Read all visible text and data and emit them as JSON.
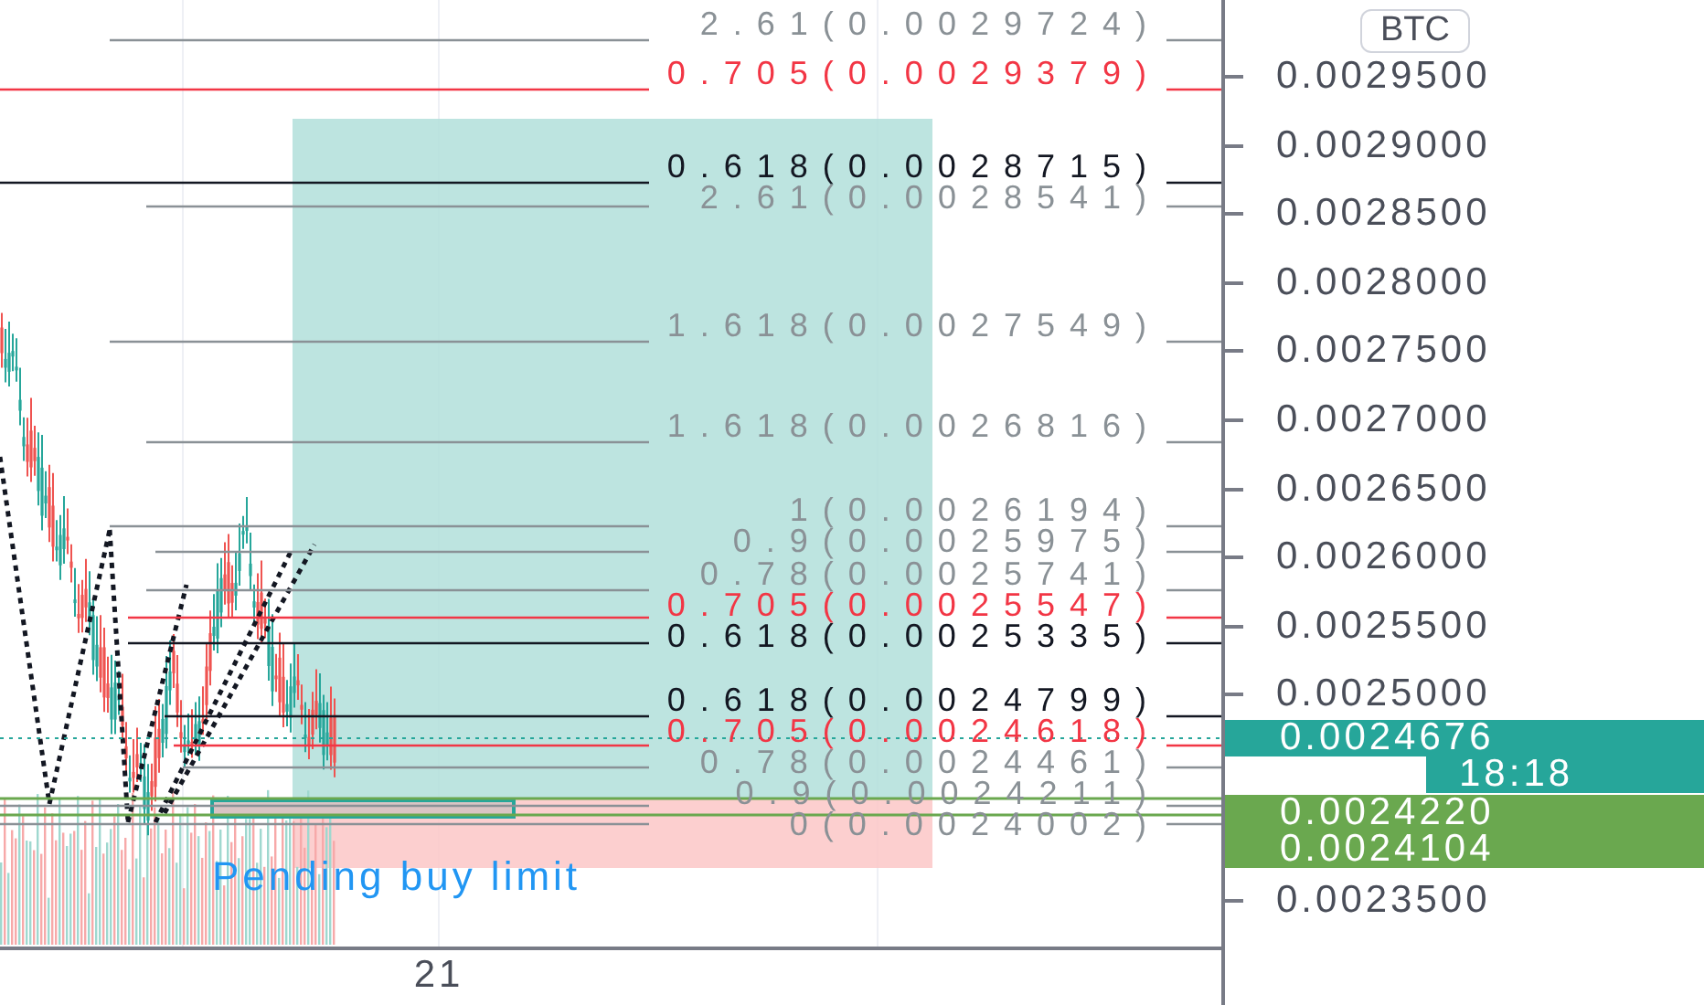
{
  "chart": {
    "currency": "BTC",
    "position": {
      "kind": "long",
      "label": "Pending buy limit"
    },
    "fib_levels": [
      {
        "label": "2.61(0.0029724)",
        "color": "#8a9196"
      },
      {
        "label": "0.705(0.0029379)",
        "color": "#f23645"
      },
      {
        "label": "0.618(0.0028715)",
        "color": "#131722"
      },
      {
        "label": "2.61(0.0028541)",
        "color": "#8a9196"
      },
      {
        "label": "1.618(0.0027549)",
        "color": "#8a9196"
      },
      {
        "label": "1.618(0.0026816)",
        "color": "#8a9196"
      },
      {
        "label": "1(0.0026194)",
        "color": "#8a9196"
      },
      {
        "label": "0.9(0.0025975)",
        "color": "#8a9196"
      },
      {
        "label": "0.78(0.0025741)",
        "color": "#8a9196"
      },
      {
        "label": "0.705(0.0025547)",
        "color": "#f23645"
      },
      {
        "label": "0.618(0.0025335)",
        "color": "#131722"
      },
      {
        "label": "0.618(0.0024799)",
        "color": "#131722"
      },
      {
        "label": "0.705(0.0024618)",
        "color": "#f23645"
      },
      {
        "label": "0.78(0.0024461)",
        "color": "#8a9196"
      },
      {
        "label": "0.9(0.0024211)",
        "color": "#8a9196"
      },
      {
        "label": "0(0.0024002)",
        "color": "#8a9196"
      }
    ],
    "price_axis": {
      "ticks": [
        "0.0029500",
        "0.0029000",
        "0.0028500",
        "0.0028000",
        "0.0027500",
        "0.0027000",
        "0.0026500",
        "0.0026000",
        "0.0025500",
        "0.0025000",
        "0.0023500"
      ],
      "badges": [
        {
          "text": "0.0024676",
          "color": "#26a69a"
        },
        {
          "text": "18:18",
          "color": "#26a69a"
        },
        {
          "text": "0.0024220",
          "color": "#6aa84f"
        },
        {
          "text": "0.0024104",
          "color": "#6aa84f"
        }
      ]
    },
    "time_axis": {
      "labels": [
        "21"
      ]
    }
  }
}
